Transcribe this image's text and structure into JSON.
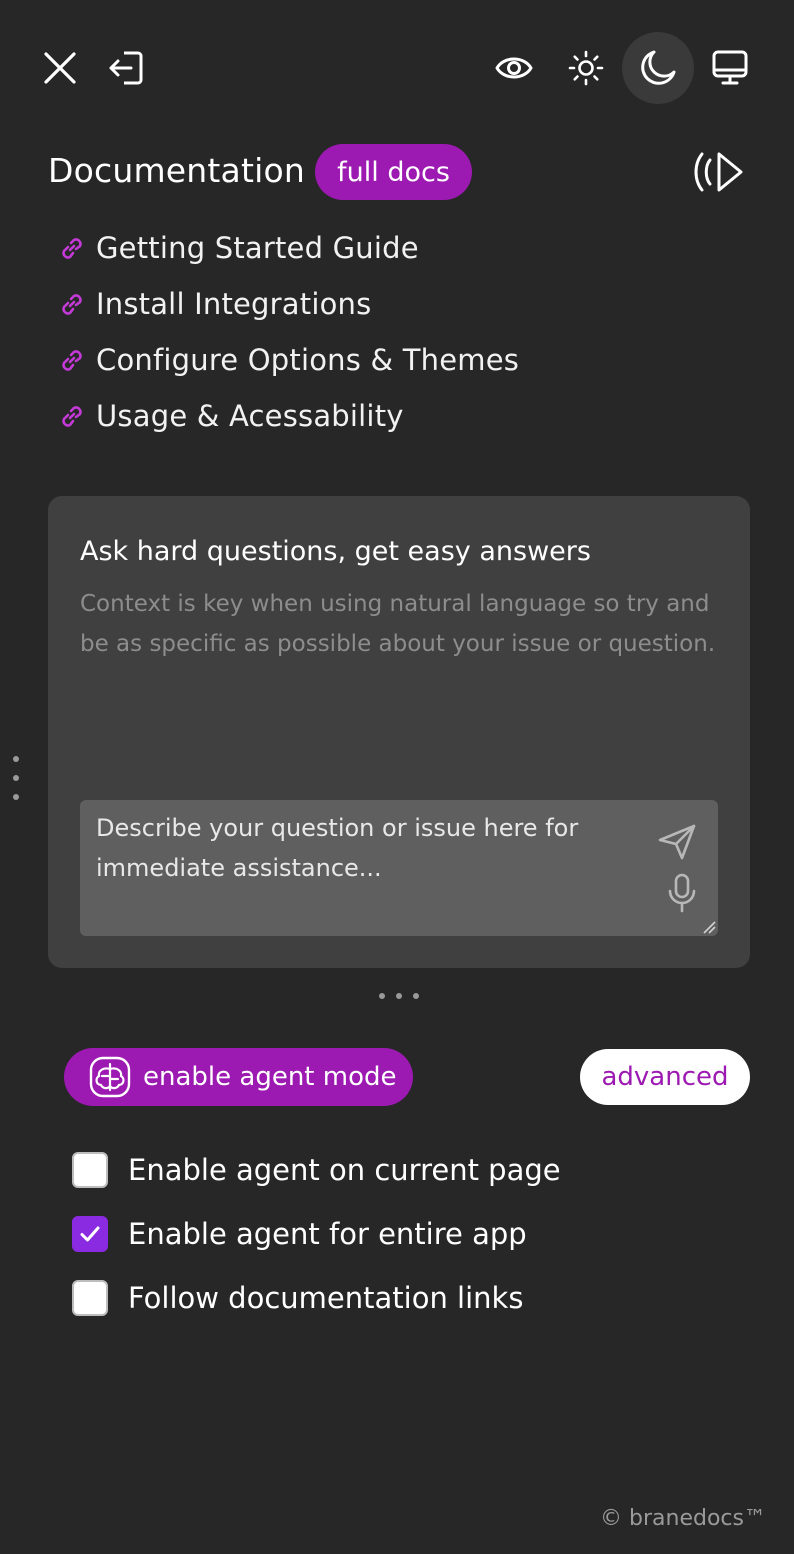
{
  "toolbar": {
    "icons": [
      "close-icon",
      "exit-icon",
      "eye-icon",
      "sun-icon",
      "moon-icon",
      "monitor-icon"
    ],
    "active_theme": "moon"
  },
  "documentation": {
    "title": "Documentation",
    "full_docs_label": "full docs",
    "audio_icon": "speaker-waves-icon",
    "links": [
      {
        "label": "Getting Started Guide",
        "icon": "link-icon"
      },
      {
        "label": "Install Integrations",
        "icon": "link-icon"
      },
      {
        "label": "Configure Options & Themes",
        "icon": "link-icon"
      },
      {
        "label": "Usage & Acessability",
        "icon": "link-icon"
      }
    ]
  },
  "ask": {
    "heading": "Ask hard questions, get easy answers",
    "description": "Context is key when using natural language so try and be as specific as possible about your issue or question.",
    "input_placeholder": "Describe your question or issue here for immediate assistance...",
    "send_icon": "send-icon",
    "mic_icon": "microphone-icon"
  },
  "agent": {
    "mode_label": "enable agent mode",
    "advanced_label": "advanced",
    "options": [
      {
        "label": "Enable agent on current page",
        "checked": false
      },
      {
        "label": "Enable agent for entire app",
        "checked": true
      },
      {
        "label": "Follow documentation links",
        "checked": false
      }
    ]
  },
  "footer": {
    "copyright": "© branedocs™"
  },
  "colors": {
    "background": "#272727",
    "card": "#404040",
    "input": "#5f5f5f",
    "accent": "#9c1ab1",
    "link_icon": "#c43ad6",
    "checkbox_checked": "#8a2be2"
  }
}
